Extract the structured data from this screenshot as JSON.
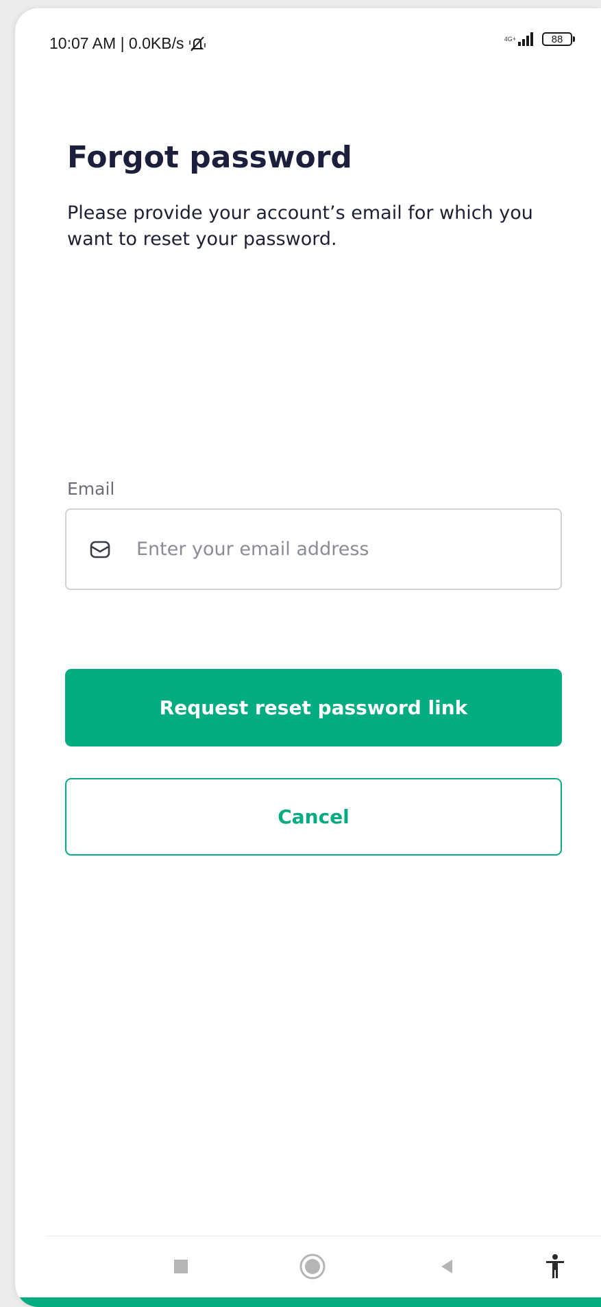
{
  "status_bar": {
    "time_speed": "10:07 AM | 0.0KB/s",
    "network_type": "4G+",
    "battery_level": "88"
  },
  "screen": {
    "title": "Forgot password",
    "subtitle": "Please provide your account’s email for which you want to reset your password."
  },
  "email": {
    "label": "Email",
    "placeholder": "Enter your email address",
    "value": ""
  },
  "actions": {
    "primary_label": "Request reset password link",
    "secondary_label": "Cancel"
  },
  "nav_bar": {
    "icons": [
      "square-recents-icon",
      "circle-home-icon",
      "triangle-back-icon",
      "accessibility-icon"
    ]
  },
  "colors": {
    "accent": "#05ac82",
    "title": "#1b1f3b",
    "field_border": "#cfd2d8",
    "placeholder": "#8a8d95",
    "background": "#ffffff"
  }
}
